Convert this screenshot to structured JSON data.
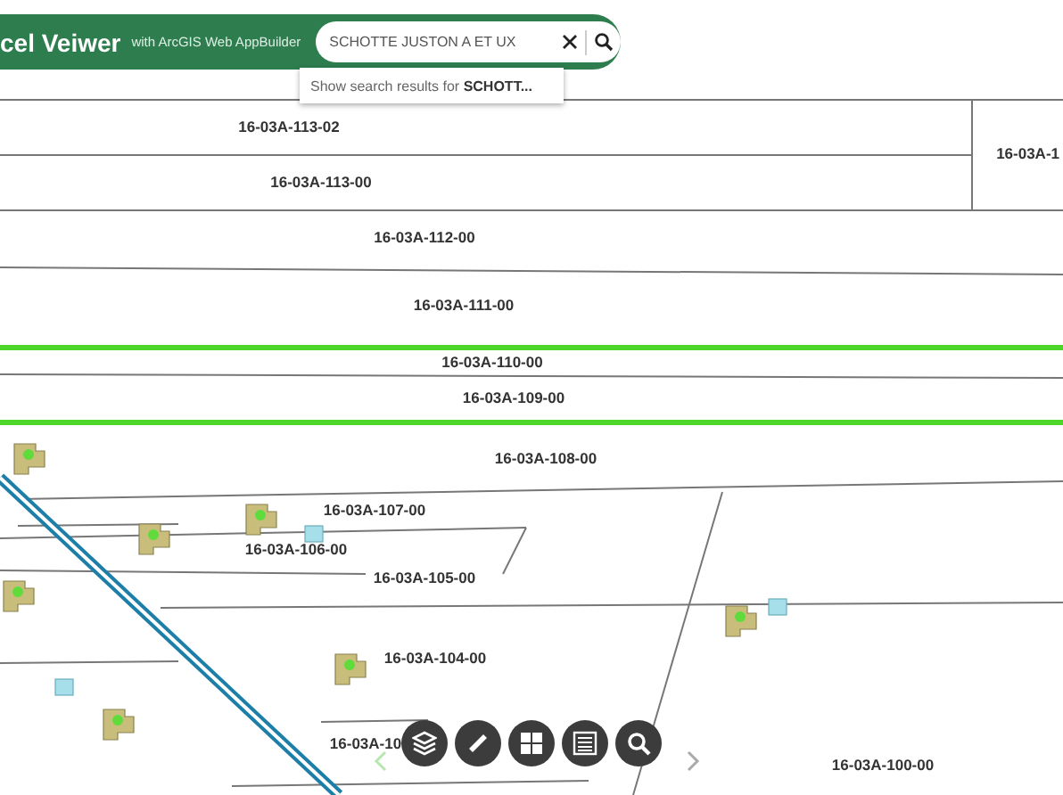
{
  "header": {
    "title": "cel Veiwer",
    "subtitle": "with ArcGIS Web AppBuilder"
  },
  "search": {
    "value": "SCHOTTE JUSTON A ET UX",
    "suggestion": "Show search results for **SCHOTT...**"
  },
  "map": {
    "parcel_labels": [
      "16-03A-113-02",
      "16-03A-113-00",
      "16-03A-1",
      "16-03A-112-00",
      "16-03A-111-00",
      "16-03A-110-00",
      "16-03A-109-00",
      "16-03A-108-00",
      "16-03A-107-00",
      "16-03A-106-00",
      "16-03A-105-00",
      "16-03A-104-00",
      "16-03A-10",
      "16-03A-100-00"
    ]
  },
  "toolbar": [
    {
      "kind": "layers"
    },
    {
      "kind": "measure"
    },
    {
      "kind": "grid"
    },
    {
      "kind": "list"
    },
    {
      "kind": "search"
    }
  ]
}
